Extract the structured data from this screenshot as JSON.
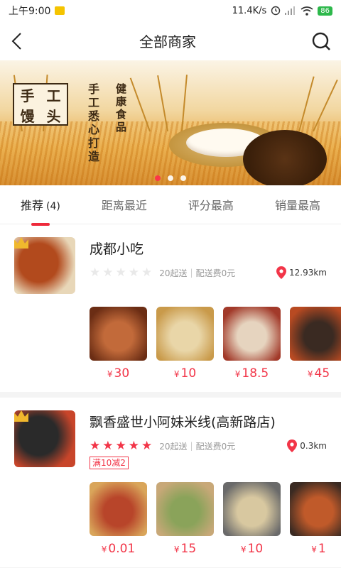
{
  "status": {
    "time": "上午9:00",
    "speed": "11.4K/s",
    "battery": "86"
  },
  "nav": {
    "title": "全部商家"
  },
  "banner": {
    "logo_chars": [
      "手",
      "工",
      "馒",
      "头"
    ],
    "line1": "手工悉心打造",
    "line2": "健康食品",
    "page_count": 3,
    "active_page": 0
  },
  "tabs": [
    {
      "label": "推荐",
      "count": "(4)",
      "active": true
    },
    {
      "label": "距离最近",
      "active": false
    },
    {
      "label": "评分最高",
      "active": false
    },
    {
      "label": "销量最高",
      "active": false
    }
  ],
  "shops": [
    {
      "name": "成都小吃",
      "rating": 0,
      "min_order": "20起送",
      "delivery_fee": "配送费0元",
      "distance": "12.93km",
      "promo": "",
      "thumb_colors": [
        "#b24a1d",
        "#e8d7b8"
      ],
      "dishes": [
        {
          "price": "30",
          "colors": [
            "#6b2d14",
            "#c26a3a"
          ]
        },
        {
          "price": "10",
          "colors": [
            "#c99a4a",
            "#e9d6a8"
          ]
        },
        {
          "price": "18.5",
          "colors": [
            "#a23a2a",
            "#e6d4bf"
          ]
        },
        {
          "price": "45",
          "colors": [
            "#b84a22",
            "#3a2a22"
          ]
        }
      ]
    },
    {
      "name": "飘香盛世小阿妹米线(高新路店)",
      "rating": 5,
      "min_order": "20起送",
      "delivery_fee": "配送费0元",
      "distance": "0.3km",
      "promo": "满10减2",
      "thumb_colors": [
        "#2a2a2a",
        "#c8452a"
      ],
      "dishes": [
        {
          "price": "0.01",
          "colors": [
            "#d9a55a",
            "#b8452a"
          ]
        },
        {
          "price": "15",
          "colors": [
            "#c8a878",
            "#8aa35a"
          ]
        },
        {
          "price": "10",
          "colors": [
            "#6a6a6a",
            "#d8c8a0"
          ]
        },
        {
          "price": "1",
          "colors": [
            "#3a2a22",
            "#c05a2a"
          ]
        }
      ]
    }
  ],
  "colors": {
    "accent": "#f23548",
    "tab_indicator": "#ee2a3b",
    "battery": "#2db84b"
  }
}
